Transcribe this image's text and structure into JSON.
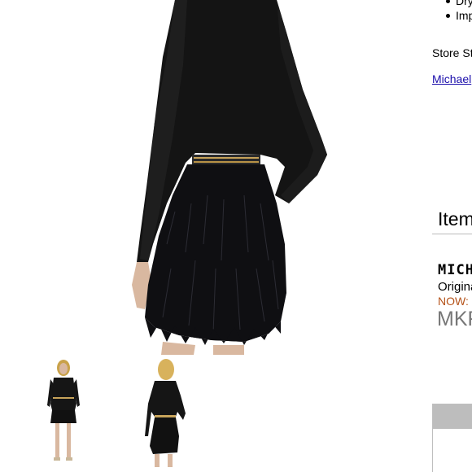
{
  "product_images": {
    "main_alt": "Back view of black jacket with chain trim and black feather skirt",
    "thumbnails": [
      {
        "alt": "Front view of outfit"
      },
      {
        "alt": "Back view of outfit"
      }
    ]
  },
  "details": {
    "bullets": [
      "Dry",
      "Imp"
    ],
    "store_style_label": "Store St",
    "brand_link": "Michael"
  },
  "item_section": {
    "heading": "Item",
    "name": "MICH",
    "original_label": "Origina",
    "now_label": "NOW:",
    "sku": "MKF"
  },
  "colors": {
    "link": "#1a0dab",
    "now_price": "#b5531a",
    "sku": "#777777",
    "panel_header": "#bdbdbd"
  }
}
